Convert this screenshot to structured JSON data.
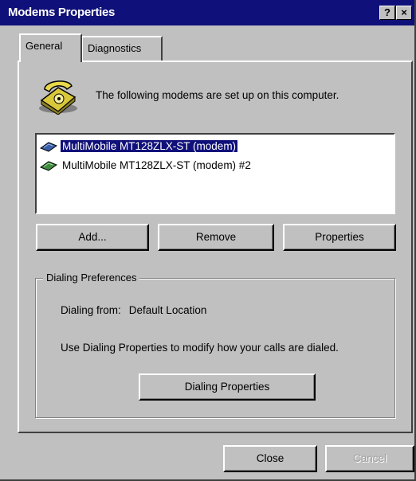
{
  "window": {
    "title": "Modems Properties",
    "help_glyph": "?",
    "close_glyph": "×"
  },
  "tabs": [
    {
      "label": "General"
    },
    {
      "label": "Diagnostics"
    }
  ],
  "general": {
    "intro_text": "The following modems are set up on this computer.",
    "modems": [
      {
        "label": "MultiMobile MT128ZLX-ST (modem)",
        "selected": true,
        "icon": "modem-icon"
      },
      {
        "label": "MultiMobile MT128ZLX-ST (modem) #2",
        "selected": false,
        "icon": "modem-icon"
      }
    ],
    "buttons": {
      "add": "Add...",
      "remove": "Remove",
      "properties": "Properties"
    },
    "dialing": {
      "legend": "Dialing Preferences",
      "from_label": "Dialing from:",
      "from_value": "Default Location",
      "description": "Use Dialing Properties to modify how your calls are dialed.",
      "button": "Dialing Properties"
    }
  },
  "footer": {
    "close": "Close",
    "cancel": "Cancel"
  },
  "colors": {
    "title_bar": "#10107a",
    "face": "#c0c0c0",
    "selection": "#10107a"
  }
}
